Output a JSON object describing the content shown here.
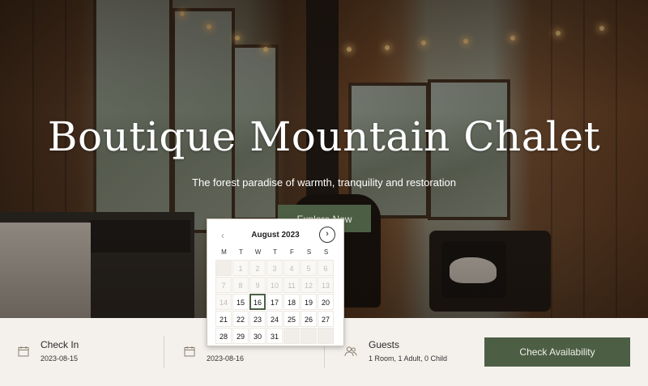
{
  "hero": {
    "title": "Boutique Mountain Chalet",
    "subtitle": "The forest paradise of warmth, tranquility and restoration",
    "explore_label": "Explore Now"
  },
  "calendar": {
    "month_label": "August 2023",
    "weekdays": [
      "M",
      "T",
      "W",
      "T",
      "F",
      "S",
      "S"
    ],
    "days": [
      "",
      "1",
      "2",
      "3",
      "4",
      "5",
      "6",
      "7",
      "8",
      "9",
      "10",
      "11",
      "12",
      "13",
      "14",
      "15",
      "16",
      "17",
      "18",
      "19",
      "20",
      "21",
      "22",
      "23",
      "24",
      "25",
      "26",
      "27",
      "28",
      "29",
      "30",
      "31",
      "",
      "",
      ""
    ],
    "disabled_until": 14,
    "selected_day": "16"
  },
  "booking": {
    "check_in_label": "Check In",
    "check_in_value": "2023-08-15",
    "check_out_value": "2023-08-16",
    "guests_label": "Guests",
    "guests_value": "1 Room, 1 Adult, 0 Child",
    "check_button_label": "Check Availability"
  },
  "colors": {
    "accent": "#4c5f45",
    "bar_background": "#f4f1ec"
  },
  "icons": [
    "calendar-icon",
    "calendar-icon",
    "guests-icon",
    "chevron-left-icon",
    "chevron-right-icon"
  ]
}
